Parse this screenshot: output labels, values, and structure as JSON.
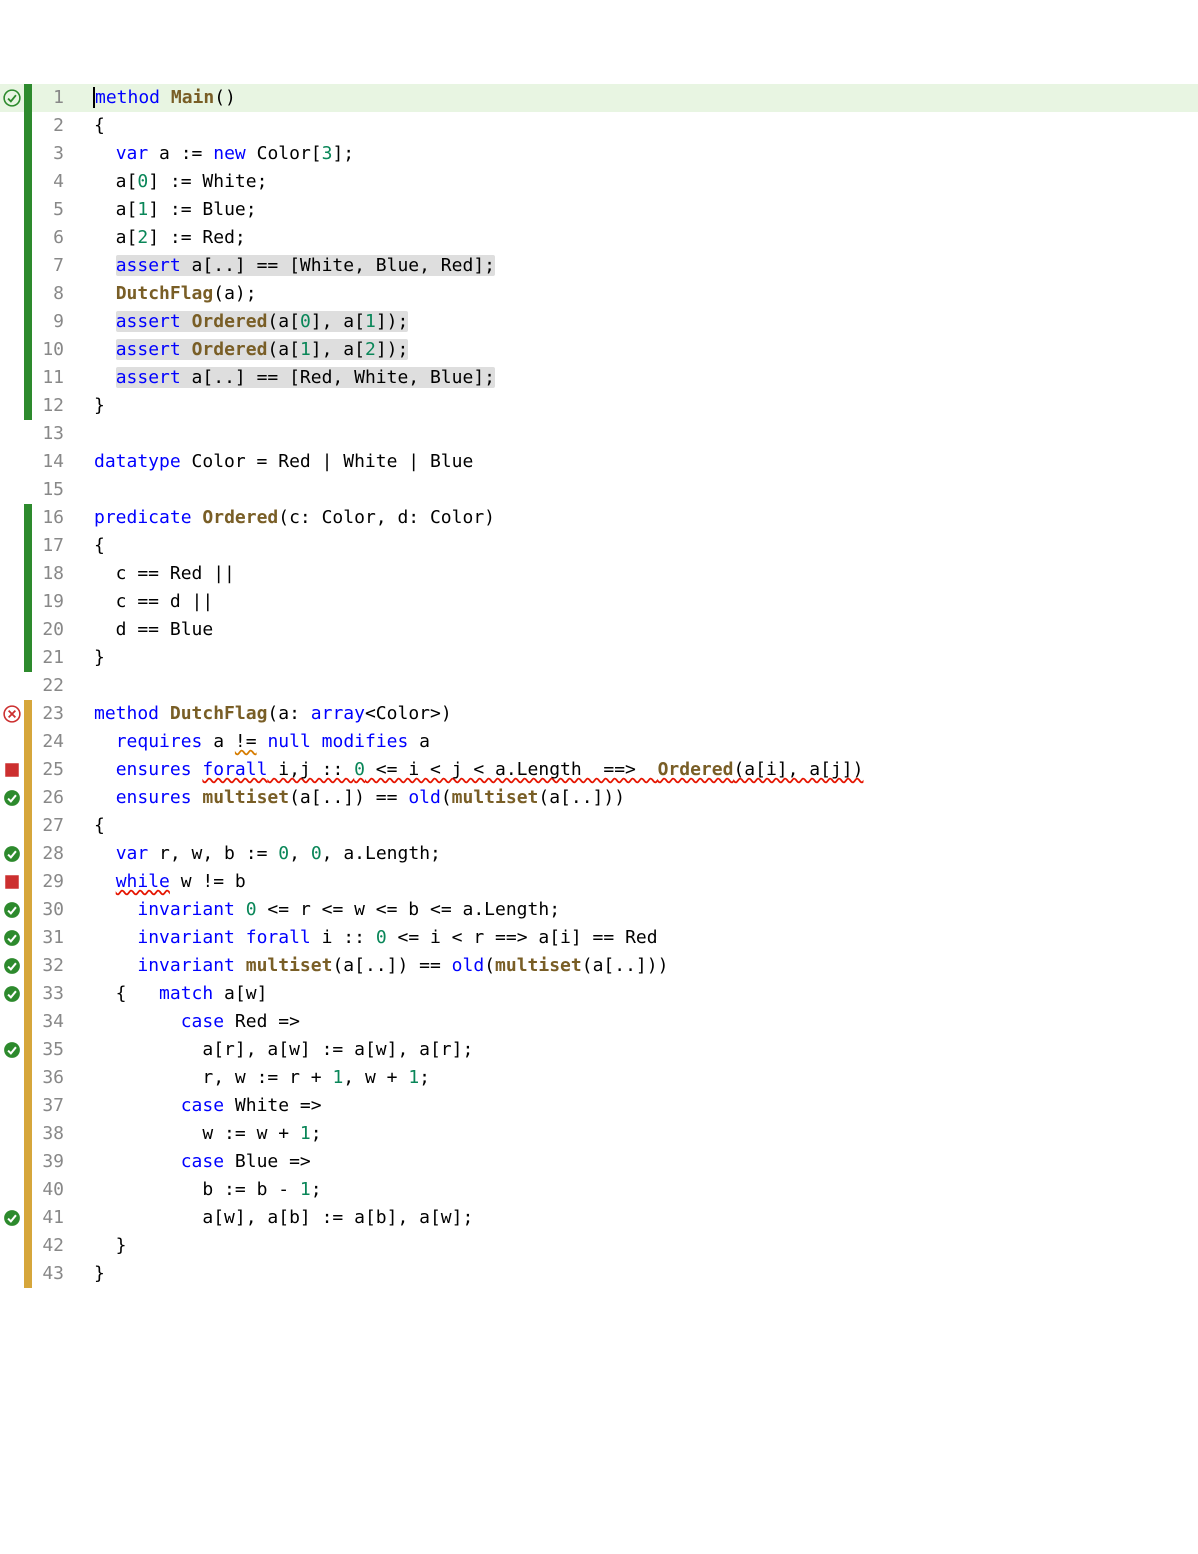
{
  "lines": [
    {
      "n": 1,
      "icon": "success",
      "bar": "green",
      "hl": true,
      "tokens": [
        {
          "t": "method ",
          "c": "kw",
          "cursor": true
        },
        {
          "t": "Main",
          "c": "name"
        },
        {
          "t": "()",
          "c": "op"
        }
      ]
    },
    {
      "n": 2,
      "icon": "",
      "bar": "green",
      "tokens": [
        {
          "t": "{",
          "c": "brace"
        }
      ]
    },
    {
      "n": 3,
      "icon": "",
      "bar": "green",
      "tokens": [
        {
          "t": "  ",
          "c": ""
        },
        {
          "t": "var",
          "c": "kw"
        },
        {
          "t": " a ",
          "c": ""
        },
        {
          "t": ":=",
          "c": "op"
        },
        {
          "t": " ",
          "c": ""
        },
        {
          "t": "new",
          "c": "kw"
        },
        {
          "t": " Color[",
          "c": ""
        },
        {
          "t": "3",
          "c": "num"
        },
        {
          "t": "];",
          "c": ""
        }
      ]
    },
    {
      "n": 4,
      "icon": "",
      "bar": "green",
      "tokens": [
        {
          "t": "  a[",
          "c": ""
        },
        {
          "t": "0",
          "c": "num"
        },
        {
          "t": "] ",
          "c": ""
        },
        {
          "t": ":=",
          "c": "op"
        },
        {
          "t": " White;",
          "c": ""
        }
      ]
    },
    {
      "n": 5,
      "icon": "",
      "bar": "green",
      "tokens": [
        {
          "t": "  a[",
          "c": ""
        },
        {
          "t": "1",
          "c": "num"
        },
        {
          "t": "] ",
          "c": ""
        },
        {
          "t": ":=",
          "c": "op"
        },
        {
          "t": " Blue;",
          "c": ""
        }
      ]
    },
    {
      "n": 6,
      "icon": "",
      "bar": "green",
      "tokens": [
        {
          "t": "  a[",
          "c": ""
        },
        {
          "t": "2",
          "c": "num"
        },
        {
          "t": "] ",
          "c": ""
        },
        {
          "t": ":=",
          "c": "op"
        },
        {
          "t": " Red;",
          "c": ""
        }
      ]
    },
    {
      "n": 7,
      "icon": "",
      "bar": "green",
      "tokens": [
        {
          "t": "  ",
          "c": ""
        },
        {
          "t": "assert a[..] == [White, Blue, Red];",
          "c": "",
          "bg": "assertbg",
          "sub": [
            {
              "t": "assert",
              "c": "kw"
            },
            {
              "t": " a[..] == [White, Blue, Red];",
              "c": ""
            }
          ]
        }
      ]
    },
    {
      "n": 8,
      "icon": "",
      "bar": "green",
      "tokens": [
        {
          "t": "  ",
          "c": ""
        },
        {
          "t": "DutchFlag",
          "c": "fn"
        },
        {
          "t": "(a);",
          "c": ""
        }
      ]
    },
    {
      "n": 9,
      "icon": "",
      "bar": "green",
      "tokens": [
        {
          "t": "  ",
          "c": ""
        },
        {
          "t": "assert Ordered(a[0], a[1]);",
          "c": "",
          "bg": "assertbg",
          "sub": [
            {
              "t": "assert",
              "c": "kw"
            },
            {
              "t": " ",
              "c": ""
            },
            {
              "t": "Ordered",
              "c": "fn"
            },
            {
              "t": "(a[",
              "c": ""
            },
            {
              "t": "0",
              "c": "num"
            },
            {
              "t": "], a[",
              "c": ""
            },
            {
              "t": "1",
              "c": "num"
            },
            {
              "t": "]);",
              "c": ""
            }
          ]
        }
      ]
    },
    {
      "n": 10,
      "icon": "",
      "bar": "green",
      "tokens": [
        {
          "t": "  ",
          "c": ""
        },
        {
          "t": "assert Ordered(a[1], a[2]);",
          "c": "",
          "bg": "assertbg",
          "sub": [
            {
              "t": "assert",
              "c": "kw"
            },
            {
              "t": " ",
              "c": ""
            },
            {
              "t": "Ordered",
              "c": "fn"
            },
            {
              "t": "(a[",
              "c": ""
            },
            {
              "t": "1",
              "c": "num"
            },
            {
              "t": "], a[",
              "c": ""
            },
            {
              "t": "2",
              "c": "num"
            },
            {
              "t": "]);",
              "c": ""
            }
          ]
        }
      ]
    },
    {
      "n": 11,
      "icon": "",
      "bar": "green",
      "tokens": [
        {
          "t": "  ",
          "c": ""
        },
        {
          "t": "assert a[..] == [Red, White, Blue];",
          "c": "",
          "bg": "assertbg",
          "sub": [
            {
              "t": "assert",
              "c": "kw"
            },
            {
              "t": " a[..] == [Red, White, Blue];",
              "c": ""
            }
          ]
        }
      ]
    },
    {
      "n": 12,
      "icon": "",
      "bar": "green",
      "tokens": [
        {
          "t": "}",
          "c": "brace"
        }
      ]
    },
    {
      "n": 13,
      "icon": "",
      "bar": "none",
      "tokens": [
        {
          "t": "",
          "c": ""
        }
      ]
    },
    {
      "n": 14,
      "icon": "",
      "bar": "none",
      "tokens": [
        {
          "t": "datatype",
          "c": "kw"
        },
        {
          "t": " Color = Red | White | Blue",
          "c": ""
        }
      ]
    },
    {
      "n": 15,
      "icon": "",
      "bar": "none",
      "tokens": [
        {
          "t": "",
          "c": ""
        }
      ]
    },
    {
      "n": 16,
      "icon": "",
      "bar": "green",
      "tokens": [
        {
          "t": "predicate",
          "c": "kw"
        },
        {
          "t": " ",
          "c": ""
        },
        {
          "t": "Ordered",
          "c": "fn"
        },
        {
          "t": "(c: Color, d: Color)",
          "c": ""
        }
      ]
    },
    {
      "n": 17,
      "icon": "",
      "bar": "green",
      "tokens": [
        {
          "t": "{",
          "c": "brace"
        }
      ]
    },
    {
      "n": 18,
      "icon": "",
      "bar": "green",
      "tokens": [
        {
          "t": "  c == Red ||",
          "c": ""
        }
      ]
    },
    {
      "n": 19,
      "icon": "",
      "bar": "green",
      "tokens": [
        {
          "t": "  c == d ||",
          "c": ""
        }
      ]
    },
    {
      "n": 20,
      "icon": "",
      "bar": "green",
      "tokens": [
        {
          "t": "  d == Blue",
          "c": ""
        }
      ]
    },
    {
      "n": 21,
      "icon": "",
      "bar": "green",
      "tokens": [
        {
          "t": "}",
          "c": "brace"
        }
      ]
    },
    {
      "n": 22,
      "icon": "",
      "bar": "none",
      "tokens": [
        {
          "t": "",
          "c": ""
        }
      ]
    },
    {
      "n": 23,
      "icon": "error",
      "bar": "yellow",
      "tokens": [
        {
          "t": "method",
          "c": "kw"
        },
        {
          "t": " ",
          "c": ""
        },
        {
          "t": "DutchFlag",
          "c": "fn"
        },
        {
          "t": "(a: ",
          "c": ""
        },
        {
          "t": "array",
          "c": "kw"
        },
        {
          "t": "<Color>)",
          "c": ""
        }
      ]
    },
    {
      "n": 24,
      "icon": "",
      "bar": "yellow",
      "tokens": [
        {
          "t": "  ",
          "c": ""
        },
        {
          "t": "requires",
          "c": "kw"
        },
        {
          "t": " a ",
          "c": ""
        },
        {
          "t": "!=",
          "c": "",
          "sq": "orange"
        },
        {
          "t": " ",
          "c": ""
        },
        {
          "t": "null",
          "c": "kw"
        },
        {
          "t": " ",
          "c": ""
        },
        {
          "t": "modifies",
          "c": "kw"
        },
        {
          "t": " a",
          "c": ""
        }
      ]
    },
    {
      "n": 25,
      "icon": "redsq",
      "bar": "yellow",
      "tokens": [
        {
          "t": "  ",
          "c": ""
        },
        {
          "t": "ensures",
          "c": "kw"
        },
        {
          "t": " ",
          "c": ""
        },
        {
          "t": "forall i,j :: 0 <= i < j < a.Length  ==>  ",
          "c": "",
          "sq": "red",
          "sub": [
            {
              "t": "forall",
              "c": "kw"
            },
            {
              "t": " i,j :: ",
              "c": ""
            },
            {
              "t": "0",
              "c": "num"
            },
            {
              "t": " <= i < j < a.Length  ==>  ",
              "c": ""
            }
          ]
        },
        {
          "t": "Ordered(a[i], a[j])",
          "c": "",
          "sq": "red",
          "sub": [
            {
              "t": "Ordered",
              "c": "fn"
            },
            {
              "t": "(a[i], a[j])",
              "c": ""
            }
          ]
        }
      ]
    },
    {
      "n": 26,
      "icon": "check",
      "bar": "yellow",
      "tokens": [
        {
          "t": "  ",
          "c": ""
        },
        {
          "t": "ensures",
          "c": "kw"
        },
        {
          "t": " ",
          "c": ""
        },
        {
          "t": "multiset",
          "c": "fn"
        },
        {
          "t": "(a[..]) == ",
          "c": ""
        },
        {
          "t": "old",
          "c": "kw"
        },
        {
          "t": "(",
          "c": ""
        },
        {
          "t": "multiset",
          "c": "fn"
        },
        {
          "t": "(a[..]))",
          "c": ""
        }
      ]
    },
    {
      "n": 27,
      "icon": "",
      "bar": "yellow",
      "tokens": [
        {
          "t": "{",
          "c": "brace"
        }
      ]
    },
    {
      "n": 28,
      "icon": "check",
      "bar": "yellow",
      "tokens": [
        {
          "t": "  ",
          "c": ""
        },
        {
          "t": "var",
          "c": "kw"
        },
        {
          "t": " r, w, b ",
          "c": ""
        },
        {
          "t": ":=",
          "c": "op"
        },
        {
          "t": " ",
          "c": ""
        },
        {
          "t": "0",
          "c": "num"
        },
        {
          "t": ", ",
          "c": ""
        },
        {
          "t": "0",
          "c": "num"
        },
        {
          "t": ", a.Length;",
          "c": ""
        }
      ]
    },
    {
      "n": 29,
      "icon": "redsq",
      "bar": "yellow",
      "tokens": [
        {
          "t": "  ",
          "c": ""
        },
        {
          "t": "while",
          "c": "kw",
          "sq": "red"
        },
        {
          "t": " w != b",
          "c": ""
        }
      ]
    },
    {
      "n": 30,
      "icon": "check",
      "bar": "yellow",
      "tokens": [
        {
          "t": "    ",
          "c": ""
        },
        {
          "t": "invariant",
          "c": "kw"
        },
        {
          "t": " ",
          "c": ""
        },
        {
          "t": "0",
          "c": "num"
        },
        {
          "t": " <= r <= w <= b <= a.Length;",
          "c": ""
        }
      ]
    },
    {
      "n": 31,
      "icon": "check",
      "bar": "yellow",
      "tokens": [
        {
          "t": "    ",
          "c": ""
        },
        {
          "t": "invariant",
          "c": "kw"
        },
        {
          "t": " ",
          "c": ""
        },
        {
          "t": "forall",
          "c": "kw"
        },
        {
          "t": " i :: ",
          "c": ""
        },
        {
          "t": "0",
          "c": "num"
        },
        {
          "t": " <= i < r ==> a[i] == Red",
          "c": ""
        }
      ]
    },
    {
      "n": 32,
      "icon": "check",
      "bar": "yellow",
      "tokens": [
        {
          "t": "    ",
          "c": ""
        },
        {
          "t": "invariant",
          "c": "kw"
        },
        {
          "t": " ",
          "c": ""
        },
        {
          "t": "multiset",
          "c": "fn"
        },
        {
          "t": "(a[..]) == ",
          "c": ""
        },
        {
          "t": "old",
          "c": "kw"
        },
        {
          "t": "(",
          "c": ""
        },
        {
          "t": "multiset",
          "c": "fn"
        },
        {
          "t": "(a[..]))",
          "c": ""
        }
      ]
    },
    {
      "n": 33,
      "icon": "check",
      "bar": "yellow",
      "tokens": [
        {
          "t": "  {   ",
          "c": ""
        },
        {
          "t": "match",
          "c": "kw"
        },
        {
          "t": " a[w]",
          "c": ""
        }
      ]
    },
    {
      "n": 34,
      "icon": "",
      "bar": "yellow",
      "tokens": [
        {
          "t": "        ",
          "c": ""
        },
        {
          "t": "case",
          "c": "kw"
        },
        {
          "t": " Red =>",
          "c": ""
        }
      ]
    },
    {
      "n": 35,
      "icon": "check",
      "bar": "yellow",
      "tokens": [
        {
          "t": "          a[r], a[w] ",
          "c": ""
        },
        {
          "t": ":=",
          "c": "op"
        },
        {
          "t": " a[w], a[r];",
          "c": ""
        }
      ]
    },
    {
      "n": 36,
      "icon": "",
      "bar": "yellow",
      "tokens": [
        {
          "t": "          r, w ",
          "c": ""
        },
        {
          "t": ":=",
          "c": "op"
        },
        {
          "t": " r + ",
          "c": ""
        },
        {
          "t": "1",
          "c": "num"
        },
        {
          "t": ", w + ",
          "c": ""
        },
        {
          "t": "1",
          "c": "num"
        },
        {
          "t": ";",
          "c": ""
        }
      ]
    },
    {
      "n": 37,
      "icon": "",
      "bar": "yellow",
      "tokens": [
        {
          "t": "        ",
          "c": ""
        },
        {
          "t": "case",
          "c": "kw"
        },
        {
          "t": " White =>",
          "c": ""
        }
      ]
    },
    {
      "n": 38,
      "icon": "",
      "bar": "yellow",
      "tokens": [
        {
          "t": "          w ",
          "c": ""
        },
        {
          "t": ":=",
          "c": "op"
        },
        {
          "t": " w + ",
          "c": ""
        },
        {
          "t": "1",
          "c": "num"
        },
        {
          "t": ";",
          "c": ""
        }
      ]
    },
    {
      "n": 39,
      "icon": "",
      "bar": "yellow",
      "tokens": [
        {
          "t": "        ",
          "c": ""
        },
        {
          "t": "case",
          "c": "kw"
        },
        {
          "t": " Blue =>",
          "c": ""
        }
      ]
    },
    {
      "n": 40,
      "icon": "",
      "bar": "yellow",
      "tokens": [
        {
          "t": "          b ",
          "c": ""
        },
        {
          "t": ":=",
          "c": "op"
        },
        {
          "t": " b - ",
          "c": ""
        },
        {
          "t": "1",
          "c": "num"
        },
        {
          "t": ";",
          "c": ""
        }
      ]
    },
    {
      "n": 41,
      "icon": "check",
      "bar": "yellow",
      "tokens": [
        {
          "t": "          a[w], a[b] ",
          "c": ""
        },
        {
          "t": ":=",
          "c": "op"
        },
        {
          "t": " a[b], a[w];",
          "c": ""
        }
      ]
    },
    {
      "n": 42,
      "icon": "",
      "bar": "yellow",
      "tokens": [
        {
          "t": "  }",
          "c": ""
        }
      ]
    },
    {
      "n": 43,
      "icon": "",
      "bar": "yellow",
      "tokens": [
        {
          "t": "}",
          "c": "brace"
        }
      ]
    }
  ]
}
